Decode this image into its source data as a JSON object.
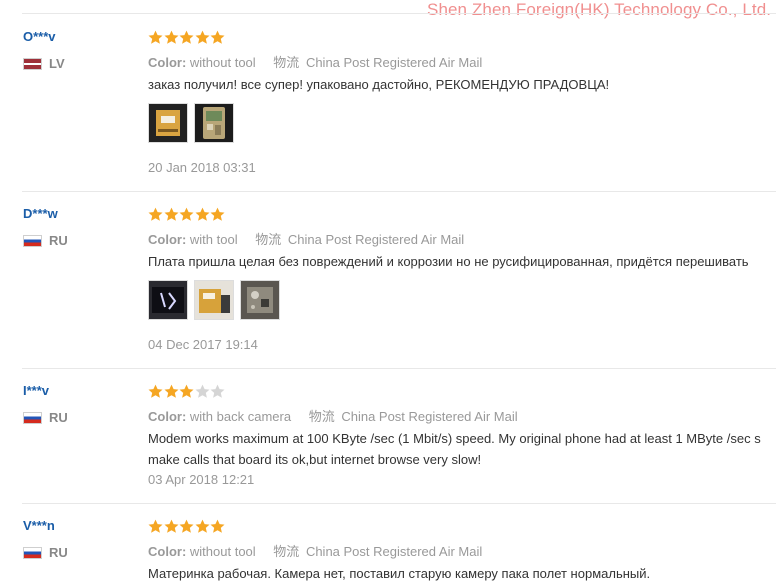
{
  "watermark": "Shen Zhen Foreign(HK) Technology Co., Ltd.",
  "labels": {
    "color": "Color:",
    "shipping_cn": "物流"
  },
  "colors": {
    "star_filled": "#f5a623",
    "star_empty": "#d5d5d5",
    "username": "#1a5da8"
  },
  "reviews": [
    {
      "user": "O***v",
      "country": "LV",
      "flag": "lv",
      "rating": 5,
      "color_value": "without tool",
      "shipping": "China Post Registered Air Mail",
      "text": "заказ получил! все супер! упаковано дастойно, РЕКОМЕНДУЮ ПРАДОВЦА!",
      "photos": [
        "photo-box-yellow",
        "photo-phone-board"
      ],
      "date": "20 Jan 2018 03:31"
    },
    {
      "user": "D***w",
      "country": "RU",
      "flag": "ru",
      "rating": 5,
      "color_value": "with tool",
      "shipping": "China Post Registered Air Mail",
      "text": "Плата пришла целая без повреждений и коррозии но не русифицированная, придётся перешивать",
      "photos": [
        "photo-screen",
        "photo-package",
        "photo-board-closeup"
      ],
      "date": "04 Dec 2017 19:14"
    },
    {
      "user": "I***v",
      "country": "RU",
      "flag": "ru",
      "rating": 3,
      "color_value": "with back camera",
      "shipping": "China Post Registered Air Mail",
      "text_lines": [
        "Modem works maximum at 100 KByte /sec (1 Mbit/s) speed. My original phone had at least 1 MByte /sec s",
        "make calls that board its ok,but internet browse very slow!"
      ],
      "date": "03 Apr 2018 12:21"
    },
    {
      "user": "V***n",
      "country": "RU",
      "flag": "ru",
      "rating": 5,
      "color_value": "without tool",
      "shipping": "China Post Registered Air Mail",
      "text": "Материнка рабочая. Камера нет, поставил старую камеру пака полет нормальный."
    }
  ]
}
